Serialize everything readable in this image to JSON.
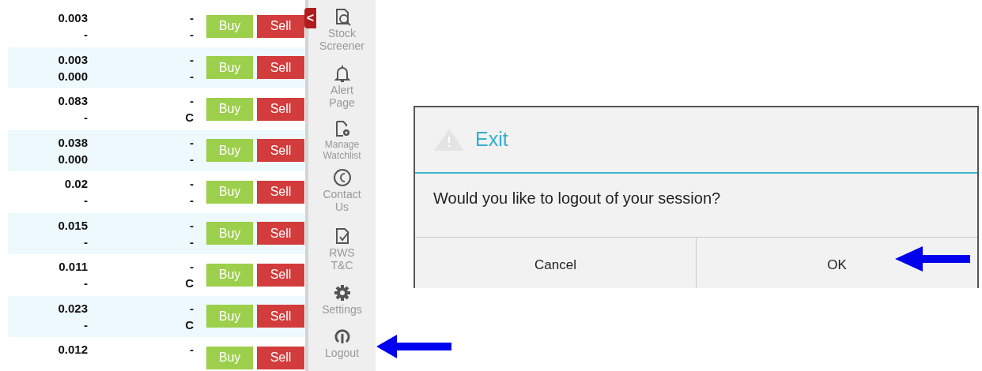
{
  "watchlist": {
    "rows": [
      {
        "value_1": "0.003",
        "value_2": "-",
        "value_3": "-",
        "value_4": "-",
        "buy": "Buy",
        "sell": "Sell"
      },
      {
        "value_1": "0.003",
        "value_2": "0.000",
        "value_3": "-",
        "value_4": "-",
        "buy": "Buy",
        "sell": "Sell"
      },
      {
        "value_1": "0.083",
        "value_2": "-",
        "value_3": "-",
        "value_4": "C",
        "buy": "Buy",
        "sell": "Sell"
      },
      {
        "value_1": "0.038",
        "value_2": "0.000",
        "value_3": "-",
        "value_4": "-",
        "buy": "Buy",
        "sell": "Sell"
      },
      {
        "value_1": "0.02",
        "value_2": "-",
        "value_3": "-",
        "value_4": "-",
        "buy": "Buy",
        "sell": "Sell"
      },
      {
        "value_1": "0.015",
        "value_2": "-",
        "value_3": "-",
        "value_4": "-",
        "buy": "Buy",
        "sell": "Sell"
      },
      {
        "value_1": "0.011",
        "value_2": "-",
        "value_3": "-",
        "value_4": "C",
        "buy": "Buy",
        "sell": "Sell"
      },
      {
        "value_1": "0.023",
        "value_2": "-",
        "value_3": "-",
        "value_4": "C",
        "buy": "Buy",
        "sell": "Sell"
      },
      {
        "value_1": "0.012",
        "value_2": "",
        "value_3": "-",
        "value_4": "",
        "buy": "Buy",
        "sell": "Sell"
      }
    ]
  },
  "sidebar": {
    "collapse_button": "<",
    "items": [
      {
        "kind": "screener",
        "label": "Stock Screener"
      },
      {
        "kind": "alert",
        "label": "Alert Page"
      },
      {
        "kind": "watchlist",
        "label": "Manage Watchlist"
      },
      {
        "kind": "contact",
        "label": "Contact Us"
      },
      {
        "kind": "terms",
        "label": "RWS T&C"
      },
      {
        "kind": "settings",
        "label": "Settings"
      },
      {
        "kind": "logout",
        "label": "Logout"
      }
    ]
  },
  "dialog": {
    "title": "Exit",
    "message": "Would you like to logout of your session?",
    "buttons": [
      "Cancel",
      "OK"
    ]
  }
}
